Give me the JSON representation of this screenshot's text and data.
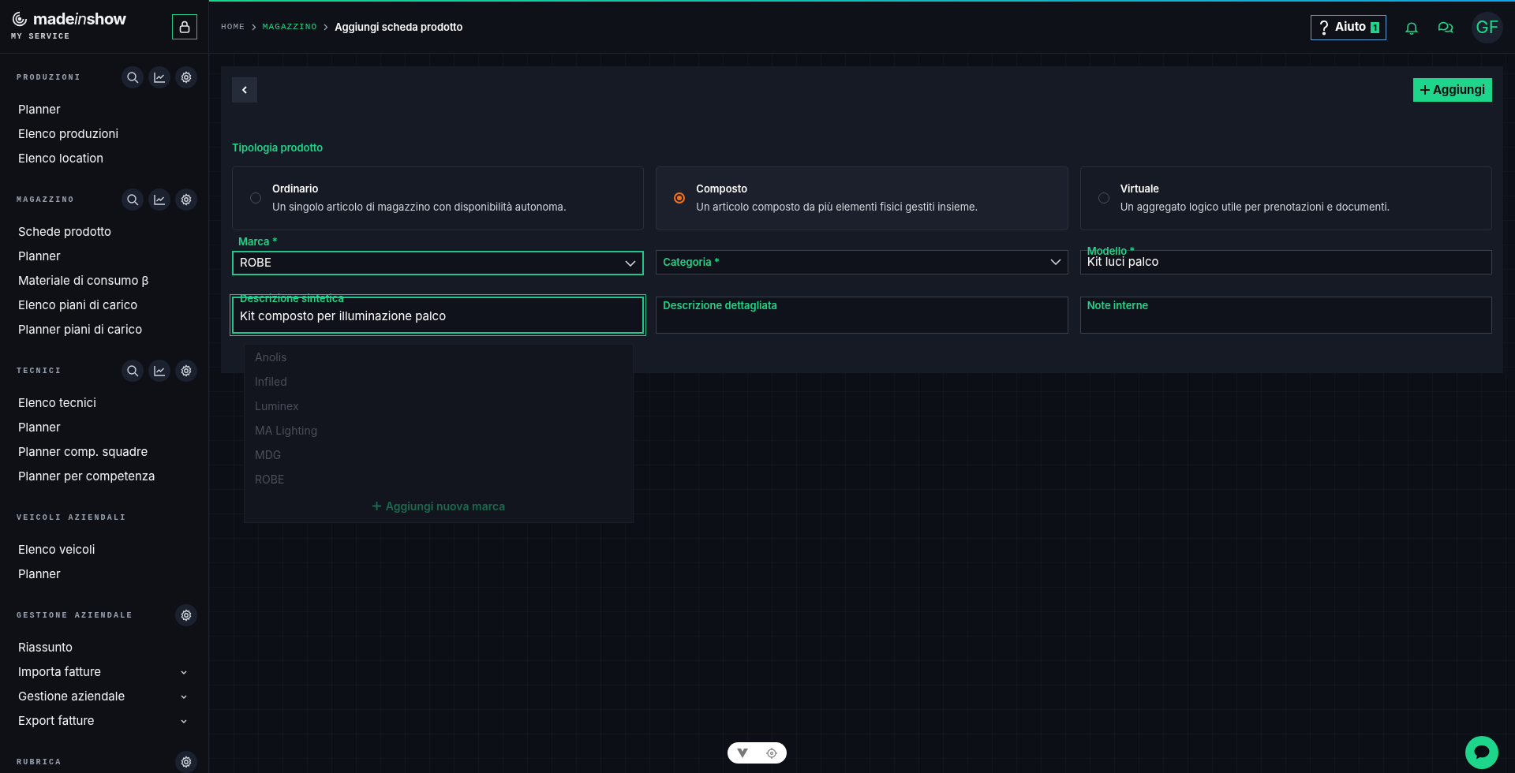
{
  "brand": {
    "logo_start": "made",
    "logo_italic": "in",
    "logo_end": "show",
    "subtitle": "MY SERVICE"
  },
  "sidebar": {
    "sections": [
      {
        "title": "PRODUZIONI",
        "search": true,
        "chart": true,
        "settings": true,
        "items": [
          {
            "label": "Planner",
            "expandable": false
          },
          {
            "label": "Elenco produzioni",
            "expandable": false
          },
          {
            "label": "Elenco location",
            "expandable": false
          }
        ]
      },
      {
        "title": "MAGAZZINO",
        "search": true,
        "chart": true,
        "settings": true,
        "items": [
          {
            "label": "Schede prodotto",
            "expandable": false
          },
          {
            "label": "Planner",
            "expandable": false
          },
          {
            "label": "Materiale di consumo β",
            "expandable": false
          },
          {
            "label": "Elenco piani di carico",
            "expandable": false
          },
          {
            "label": "Planner piani di carico",
            "expandable": false
          }
        ]
      },
      {
        "title": "TECNICI",
        "search": true,
        "chart": true,
        "settings": true,
        "items": [
          {
            "label": "Elenco tecnici",
            "expandable": false
          },
          {
            "label": "Planner",
            "expandable": false
          },
          {
            "label": "Planner comp. squadre",
            "expandable": false
          },
          {
            "label": "Planner per competenza",
            "expandable": false
          }
        ]
      },
      {
        "title": "VEICOLI AZIENDALI",
        "items": [
          {
            "label": "Elenco veicoli",
            "expandable": false
          },
          {
            "label": "Planner",
            "expandable": false
          }
        ]
      },
      {
        "title": "GESTIONE AZIENDALE",
        "settings": true,
        "items": [
          {
            "label": "Riassunto",
            "expandable": false
          },
          {
            "label": "Importa fatture",
            "expandable": true
          },
          {
            "label": "Gestione aziendale",
            "expandable": true
          },
          {
            "label": "Export fatture",
            "expandable": true
          }
        ]
      },
      {
        "title": "RUBRICA",
        "settings": true
      }
    ]
  },
  "header": {
    "breadcrumbs": [
      {
        "label": "HOME",
        "kind": "root"
      },
      {
        "label": "MAGAZZINO",
        "kind": "section"
      },
      {
        "label": "Aggiungi scheda prodotto",
        "kind": "current"
      }
    ],
    "help": {
      "label": "Aiuto",
      "badge": "1"
    },
    "avatar": "GF"
  },
  "form": {
    "add_button": "Aggiungi",
    "product_type": {
      "label": "Tipologia prodotto",
      "options": [
        {
          "title": "Ordinario",
          "description": "Un singolo articolo di magazzino con disponibilità autonoma.",
          "selected": false
        },
        {
          "title": "Composto",
          "description": "Un articolo composto da più elementi fisici gestiti insieme.",
          "selected": true
        },
        {
          "title": "Virtuale",
          "description": "Un aggregato logico utile per prenotazioni e documenti.",
          "selected": false
        }
      ]
    },
    "fields": [
      {
        "label": "Marca *",
        "value": "ROBE",
        "kind": "select",
        "focused": true
      },
      {
        "label": "Categoria *",
        "kind": "select",
        "focused": false
      },
      {
        "label": "Modello *",
        "value": "Kit luci palco",
        "kind": "text",
        "focused": false
      },
      {
        "label": "Descrizione sintetica",
        "value": "Kit composto per illuminazione palco",
        "kind": "textarea",
        "focused": true
      },
      {
        "label": "Descrizione dettagliata",
        "kind": "textarea",
        "focused": false
      },
      {
        "label": "Note interne",
        "kind": "textarea",
        "focused": false
      }
    ],
    "brand_dropdown": {
      "options": [
        "Anolis",
        "Infiled",
        "Luminex",
        "MA Lighting",
        "MDG",
        "ROBE"
      ],
      "add_label": "Aggiungi nuova marca"
    }
  }
}
